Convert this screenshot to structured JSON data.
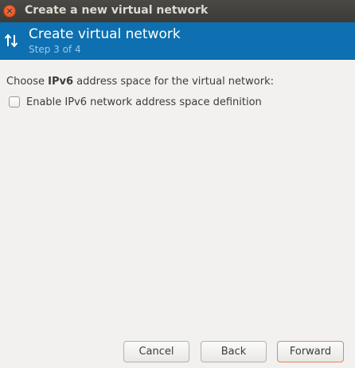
{
  "window": {
    "title": "Create a new virtual network"
  },
  "header": {
    "title": "Create virtual network",
    "step": "Step 3 of 4",
    "background_color": "#0e70b0"
  },
  "body": {
    "prompt_prefix": "Choose ",
    "prompt_bold": "IPv6",
    "prompt_suffix": " address space for the virtual network:",
    "enable_ipv6_label": "Enable IPv6 network address space definition",
    "enable_ipv6_checked": false
  },
  "buttons": {
    "cancel": "Cancel",
    "back": "Back",
    "forward": "Forward"
  },
  "icons": {
    "close": "close-icon",
    "header": "network-arrows-icon"
  }
}
